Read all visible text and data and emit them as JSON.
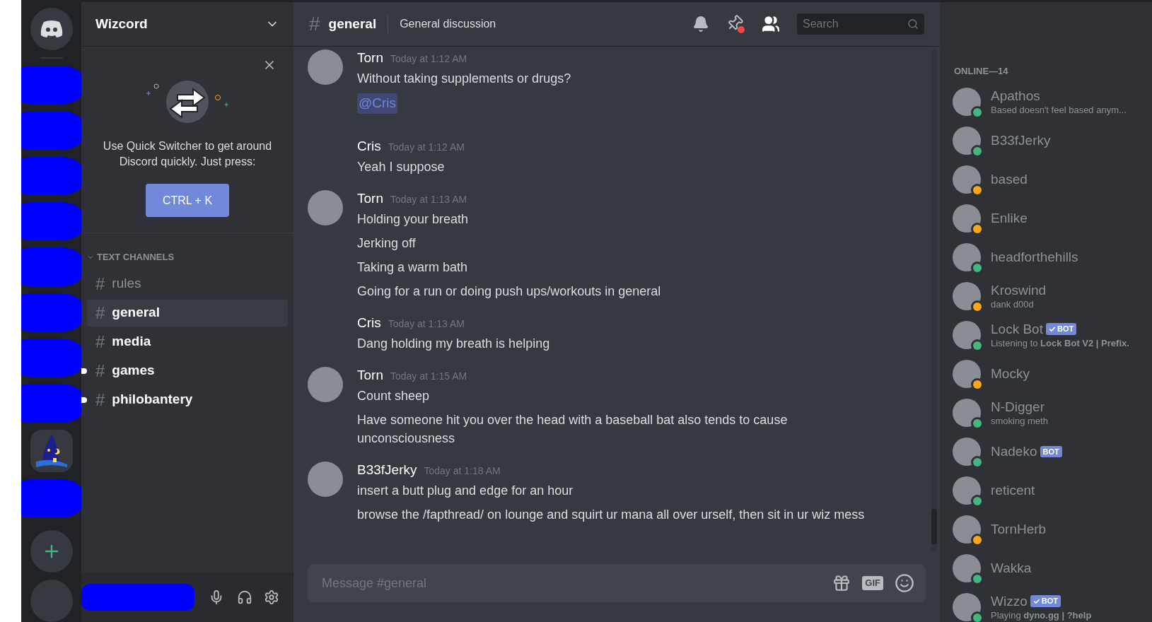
{
  "server": {
    "name": "Wizcord"
  },
  "quick_switcher": {
    "text": "Use Quick Switcher to get around Discord quickly. Just press:",
    "shortcut": "CTRL + K"
  },
  "category": {
    "label": "TEXT CHANNELS",
    "expanded": true
  },
  "channels": [
    {
      "icon": "#",
      "name": "rules",
      "selected": false,
      "unread": false,
      "pill": false
    },
    {
      "icon": "#",
      "name": "general",
      "selected": true,
      "unread": true,
      "pill": false
    },
    {
      "icon": "#",
      "name": "media",
      "selected": false,
      "unread": true,
      "pill": false
    },
    {
      "icon": "#",
      "name": "games",
      "selected": false,
      "unread": true,
      "pill": true
    },
    {
      "icon": "#",
      "name": "philobantery",
      "selected": false,
      "unread": true,
      "pill": true
    }
  ],
  "header": {
    "icon": "#",
    "channel": "general",
    "topic": "General discussion",
    "search_placeholder": "Search",
    "pins_unread": true
  },
  "messages": [
    {
      "author": "Torn",
      "time": "Today at 1:12 AM",
      "avatar": true,
      "lines": [
        {
          "kind": "text",
          "text": "Without taking supplements or drugs?"
        },
        {
          "kind": "mention",
          "text": "@Cris"
        }
      ]
    },
    {
      "author": "Cris",
      "time": "Today at 1:12 AM",
      "avatar": false,
      "lines": [
        {
          "kind": "text",
          "text": "Yeah I suppose"
        }
      ]
    },
    {
      "author": "Torn",
      "time": "Today at 1:13 AM",
      "avatar": true,
      "lines": [
        {
          "kind": "text",
          "text": "Holding your breath"
        },
        {
          "kind": "text",
          "text": "Jerking off"
        },
        {
          "kind": "text",
          "text": "Taking a warm bath"
        },
        {
          "kind": "text",
          "text": "Going for a run or doing push ups/workouts in general"
        }
      ]
    },
    {
      "author": "Cris",
      "time": "Today at 1:13 AM",
      "avatar": false,
      "lines": [
        {
          "kind": "text",
          "text": "Dang holding my breath is helping"
        }
      ]
    },
    {
      "author": "Torn",
      "time": "Today at 1:15 AM",
      "avatar": true,
      "lines": [
        {
          "kind": "text",
          "text": "Count sheep"
        },
        {
          "kind": "text",
          "text": "Have someone hit you over the head with a baseball bat also tends to cause unconsciousness"
        }
      ]
    },
    {
      "author": "B33fJerky",
      "time": "Today at 1:18 AM",
      "avatar": true,
      "lines": [
        {
          "kind": "text",
          "text": "insert a butt plug and edge for an hour"
        },
        {
          "kind": "text",
          "text": "browse the /fapthread/ on lounge and squirt ur mana all over urself, then sit in ur wiz mess"
        }
      ]
    }
  ],
  "composer": {
    "placeholder": "Message #general",
    "gif": "GIF"
  },
  "members_heading": "ONLINE—14",
  "members": [
    {
      "name": "Apathos",
      "color": "#43b581",
      "activity": "Based doesn't feel based anym..."
    },
    {
      "name": "B33fJerky",
      "color": "#43b581"
    },
    {
      "name": "based",
      "color": "#faa61a"
    },
    {
      "name": "Enlike",
      "color": "#faa61a"
    },
    {
      "name": "headforthehills",
      "color": "#43b581"
    },
    {
      "name": "Kroswind",
      "color": "#faa61a",
      "activity": "dank d00d"
    },
    {
      "name": "Lock Bot",
      "color": "#43b581",
      "badge": "BOT",
      "verified": true,
      "activity": "Listening to **Lock Bot V2 | Prefix.**"
    },
    {
      "name": "Mocky",
      "color": "#faa61a"
    },
    {
      "name": "N-Digger",
      "color": "#43b581",
      "activity": "smoking meth"
    },
    {
      "name": "Nadeko",
      "color": "#43b581",
      "badge": "BOT",
      "verified": false
    },
    {
      "name": "reticent",
      "color": "#43b581"
    },
    {
      "name": "TornHerb",
      "color": "#faa61a"
    },
    {
      "name": "Wakka",
      "color": "#43b581"
    },
    {
      "name": "Wizzo",
      "color": "#43b581",
      "badge": "BOT",
      "verified": true,
      "activity": "Playing **dyno.gg | ?help**"
    }
  ]
}
